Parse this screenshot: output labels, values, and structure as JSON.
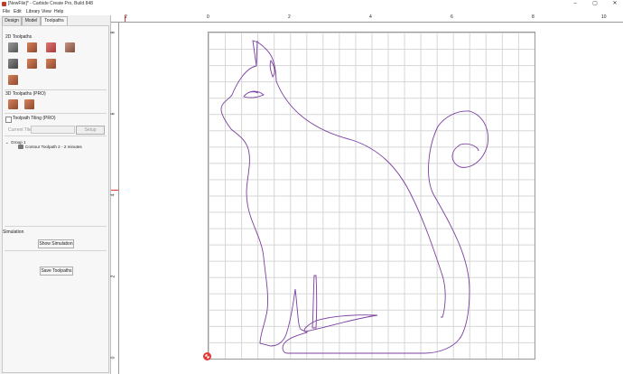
{
  "window": {
    "title": "[NewFile]* - Carbide Create Pro, Build 848"
  },
  "window_controls": [
    "–",
    "▢",
    "✕"
  ],
  "menu": [
    "File",
    "Edit",
    "Library",
    "View",
    "Help"
  ],
  "tabs": [
    {
      "label": "Design"
    },
    {
      "label": "Model"
    },
    {
      "label": "Toolpaths"
    }
  ],
  "toolpaths_2d": {
    "label": "2D Toolpaths"
  },
  "toolpaths_3d": {
    "label": "3D Toolpaths (PRO)"
  },
  "tiling": {
    "label": "Toolpath Tiling (PRO)",
    "current_tile_label": "Current Tile",
    "setup_label": "Setup"
  },
  "tree": {
    "group_label": "Group 1",
    "item_label": "Contour Toolpath 2 - 2 minutes"
  },
  "simulation": {
    "label": "Simulation",
    "show_button": "Show Simulation"
  },
  "save_button": "Save Toolpaths",
  "ruler": {
    "h_labels": [
      "2",
      "0",
      "2",
      "4",
      "6",
      "8",
      "10"
    ],
    "v_labels": [
      "8",
      "6",
      "4",
      "2",
      "0"
    ]
  },
  "colors": {
    "toolpath": "#7b3fa0",
    "origin": "#e53935",
    "accent": "#c0392b"
  },
  "icons": [
    "app-icon",
    "toolpath-2d-icon",
    "toolpath-3d-icon",
    "origin-marker-icon"
  ]
}
